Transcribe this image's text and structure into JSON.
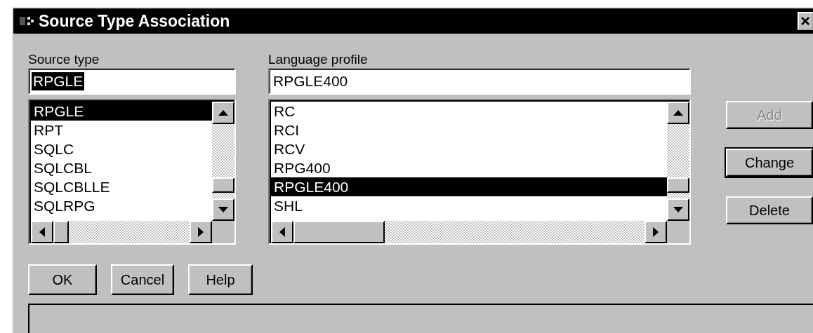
{
  "window": {
    "title": "Source Type Association"
  },
  "source_type": {
    "label": "Source type",
    "value": "RPGLE",
    "value_selected": true,
    "items": [
      {
        "label": "RPGLE",
        "selected": true
      },
      {
        "label": "RPT",
        "selected": false
      },
      {
        "label": "SQLC",
        "selected": false
      },
      {
        "label": "SQLCBL",
        "selected": false
      },
      {
        "label": "SQLCBLLE",
        "selected": false
      },
      {
        "label": "SQLRPG",
        "selected": false
      }
    ]
  },
  "language_profile": {
    "label": "Language profile",
    "value": "RPGLE400",
    "value_selected": false,
    "items": [
      {
        "label": "RC",
        "selected": false
      },
      {
        "label": "RCI",
        "selected": false
      },
      {
        "label": "RCV",
        "selected": false
      },
      {
        "label": "RPG400",
        "selected": false
      },
      {
        "label": "RPGLE400",
        "selected": true
      },
      {
        "label": "SHL",
        "selected": false
      }
    ]
  },
  "side_buttons": [
    {
      "label": "Add",
      "disabled": true,
      "default": false
    },
    {
      "label": "Change",
      "disabled": false,
      "default": true
    },
    {
      "label": "Delete",
      "disabled": false,
      "default": false
    }
  ],
  "bottom_buttons": [
    {
      "label": "OK"
    },
    {
      "label": "Cancel"
    },
    {
      "label": "Help"
    }
  ]
}
